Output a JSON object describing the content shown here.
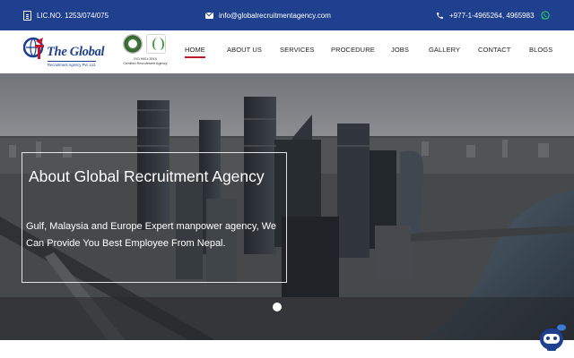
{
  "topbar": {
    "license": "LIC.NO. 1253/074/075",
    "email": "info@globalrecruitmentagency.com",
    "phone": "+977-1-4965264, 4965983"
  },
  "logo": {
    "title": "The Global",
    "subtitle": "Recruitment Agency Pvt. Ltd."
  },
  "cert": {
    "line1": "ISO 9001:2015",
    "line2": "Certified Recruitment Agency"
  },
  "nav": {
    "items": [
      {
        "label": "HOME",
        "active": true
      },
      {
        "label": "ABOUT US"
      },
      {
        "label": "SERVICES"
      },
      {
        "label": "PROCEDURE"
      },
      {
        "label": "JOBS"
      },
      {
        "label": "GALLERY"
      },
      {
        "label": "CONTACT"
      },
      {
        "label": "BLOGS"
      }
    ]
  },
  "hero": {
    "title": "About Global Recruitment Agency",
    "text": "Gulf, Malaysia and Europe Expert manpower agency, We Can Provide You Best Employee From Nepal."
  },
  "colors": {
    "topbar": "#1f3f8f",
    "accent": "#c0182a",
    "whatsapp": "#25d366"
  },
  "icons": {
    "license": "document-icon",
    "email": "mail-icon",
    "phone": "phone-icon",
    "whatsapp": "whatsapp-icon",
    "chat": "chatbot-icon"
  }
}
